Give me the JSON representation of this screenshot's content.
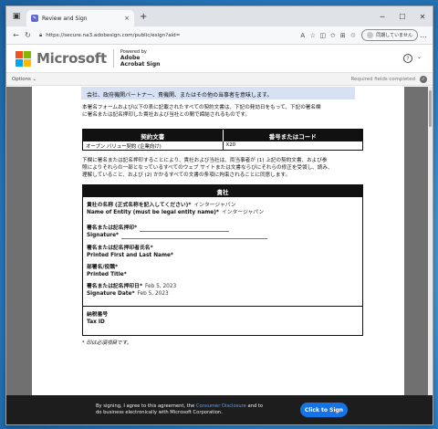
{
  "browser": {
    "tab_title": "Review and Sign",
    "url": "https://secure.na3.adobesign.com/public/esign?aid=",
    "paused_label": "同期していません",
    "tab_close": "×",
    "new_tab": "+"
  },
  "header": {
    "brand": "Microsoft",
    "powered_by": "Powered by",
    "product_line1": "Adobe",
    "product_line2": "Acrobat Sign",
    "colors": {
      "red": "#f25022",
      "green": "#7fba00",
      "blue": "#00a4ef",
      "yellow": "#ffb900"
    }
  },
  "optionsbar": {
    "options_label": "Options ⌄",
    "required_status": "Required fields completed"
  },
  "document": {
    "notice": "会社、政府機関パートナー、貴機関、またはその他の当事者を意味します。",
    "intro_line1": "本署名フォームおよび以下の表に記載されたすべての契約文書は、下記の発効日をもって、下記の署名欄",
    "intro_line2": "に署名または記名押印した貴社および当社との間で締結されるものです。",
    "table": {
      "col1_header": "契約文書",
      "col2_header": "番号またはコード",
      "row_doc": "オープン バリュー契約 (企業向け)",
      "row_code": "X20"
    },
    "para2_line1": "下欄に署名または記名押印することにより、貴社および当社は、両当事者が (1) 上記の契約文書、および参",
    "para2_line2": "照によりそれらの一部となっているすべてのウェブ サイトまたは文書ならびにそれらの修正を受領し、読み、",
    "para2_line3": "理解していること、および (2) かかるすべての文書の条項に拘束されることに同意します。",
    "company_section_title": "貴社",
    "entity_label_ja": "貴社の名称 (正式名称を記入してください)*",
    "entity_label_en": "Name of Entity (must be legal entity name)*",
    "entity_value_1": "インタージャパン",
    "entity_value_2": "インタージャパン",
    "signature_label_ja": "署名または記名押印*",
    "signature_label_en": "Signature*",
    "printed_name_ja": "署名または記名押印者氏名*",
    "printed_name_en": "Printed First and Last Name*",
    "title_ja": "部署名/役職*",
    "title_en": "Printed Title*",
    "date_label_ja": "署名または記名押印日*",
    "date_label_en": "Signature Date*",
    "date_value_1": "Feb 5, 2023",
    "date_value_2": "Feb 5, 2023",
    "tax_id_ja": "納税番号",
    "tax_id_en": "Tax ID",
    "footnote": "* 印は必須項目です。"
  },
  "consent": {
    "text_before": "By signing, I agree to this agreement, the",
    "link": "Consumer Disclosure",
    "text_after": "and to do business electronically with Microsoft Corporation.",
    "button": "Click to Sign"
  }
}
